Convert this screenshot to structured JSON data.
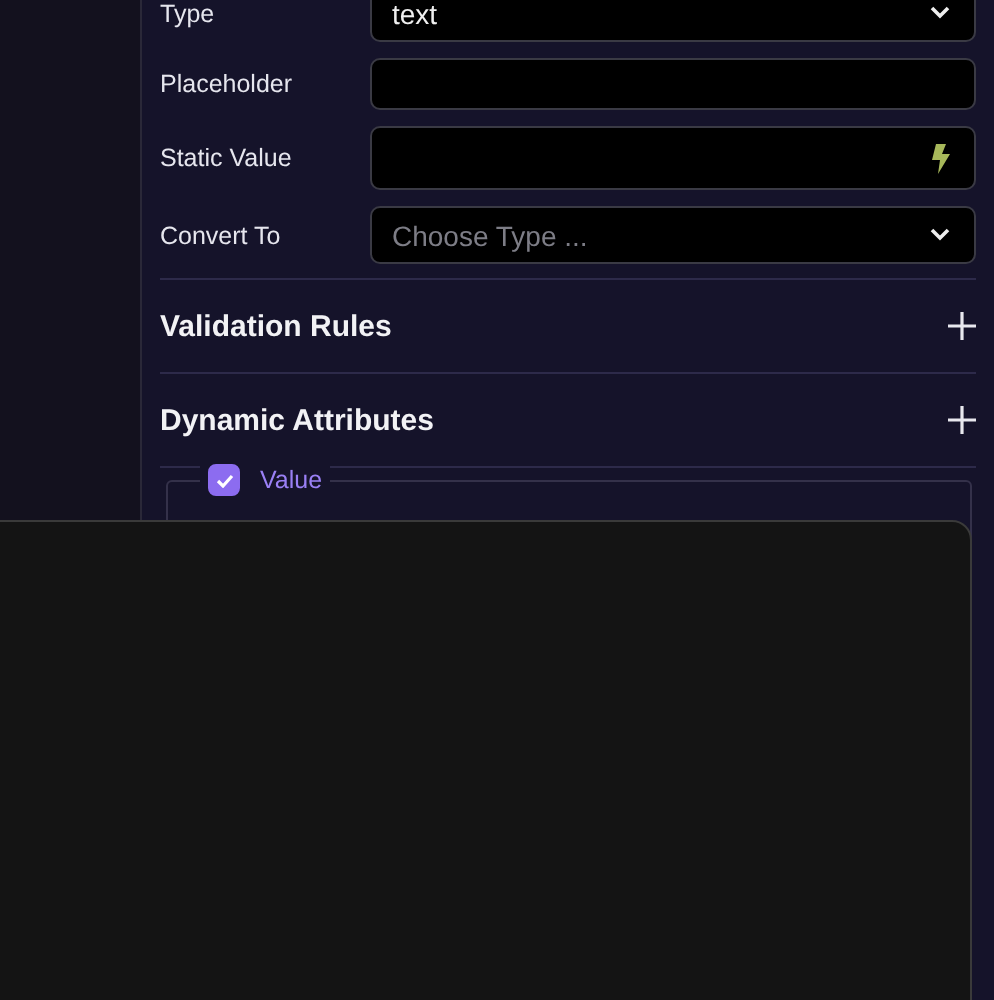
{
  "fields": [
    {
      "label": "Type",
      "kind": "select",
      "value": "text"
    },
    {
      "label": "Placeholder",
      "kind": "input"
    },
    {
      "label": "Static Value",
      "kind": "dynamic"
    },
    {
      "label": "Convert To",
      "kind": "select",
      "placeholder": "Choose Type ..."
    }
  ],
  "sections": [
    {
      "title": "Validation Rules"
    },
    {
      "title": "Dynamic Attributes"
    }
  ],
  "attribute": {
    "label": "Value",
    "checked": true
  }
}
